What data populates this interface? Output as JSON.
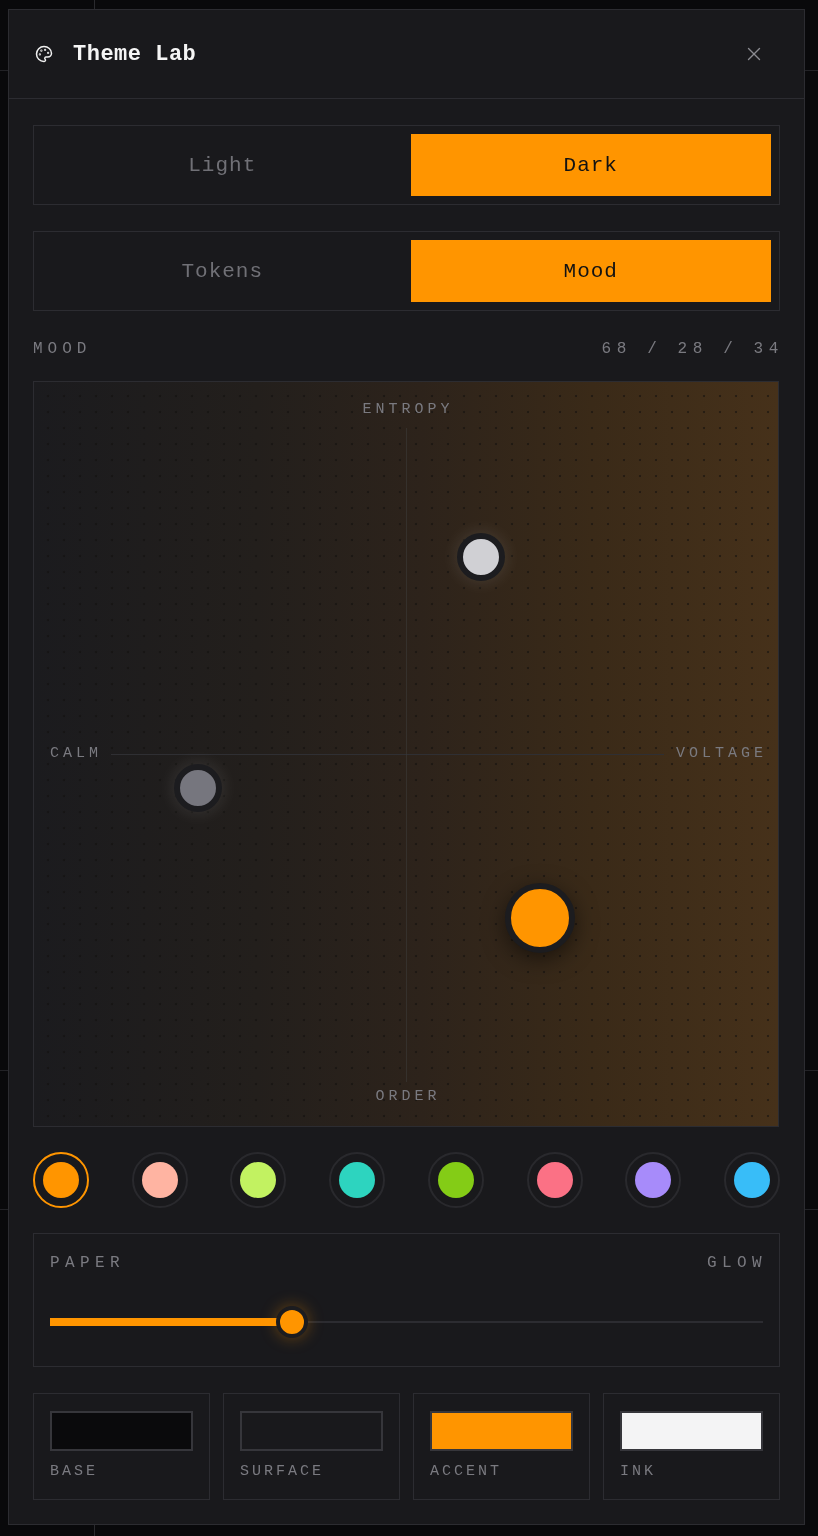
{
  "window": {
    "title": "Theme Lab"
  },
  "theme_toggle": [
    {
      "label": "Light",
      "selected": false
    },
    {
      "label": "Dark",
      "selected": true
    }
  ],
  "view_tabs": [
    {
      "label": "Tokens",
      "selected": false
    },
    {
      "label": "Mood",
      "selected": true
    }
  ],
  "mood": {
    "label": "MOOD",
    "reading": "68 / 28 / 34",
    "axes": {
      "top": "ENTROPY",
      "left": "CALM",
      "right": "VOLTAGE",
      "bottom": "ORDER"
    },
    "handles": [
      {
        "kind": "satellite",
        "color": "#d0d0d4"
      },
      {
        "kind": "satellite",
        "color": "#76767e"
      },
      {
        "kind": "main",
        "color": "#ff9500"
      }
    ]
  },
  "swatches": [
    {
      "color": "#ff9500",
      "selected": true
    },
    {
      "color": "#ffb4a2",
      "selected": false
    },
    {
      "color": "#c2f261",
      "selected": false
    },
    {
      "color": "#2dd4bf",
      "selected": false
    },
    {
      "color": "#84cc16",
      "selected": false
    },
    {
      "color": "#fb7185",
      "selected": false
    },
    {
      "color": "#a78bfa",
      "selected": false
    },
    {
      "color": "#38bdf8",
      "selected": false
    }
  ],
  "slider": {
    "left_label": "PAPER",
    "right_label": "GLOW",
    "level": 0.34
  },
  "tokens": [
    {
      "label": "BASE",
      "color": "#0a0a0c"
    },
    {
      "label": "SURFACE",
      "color": "#19191c"
    },
    {
      "label": "ACCENT",
      "color": "#ff9500"
    },
    {
      "label": "INK",
      "color": "#f4f4f5"
    }
  ]
}
